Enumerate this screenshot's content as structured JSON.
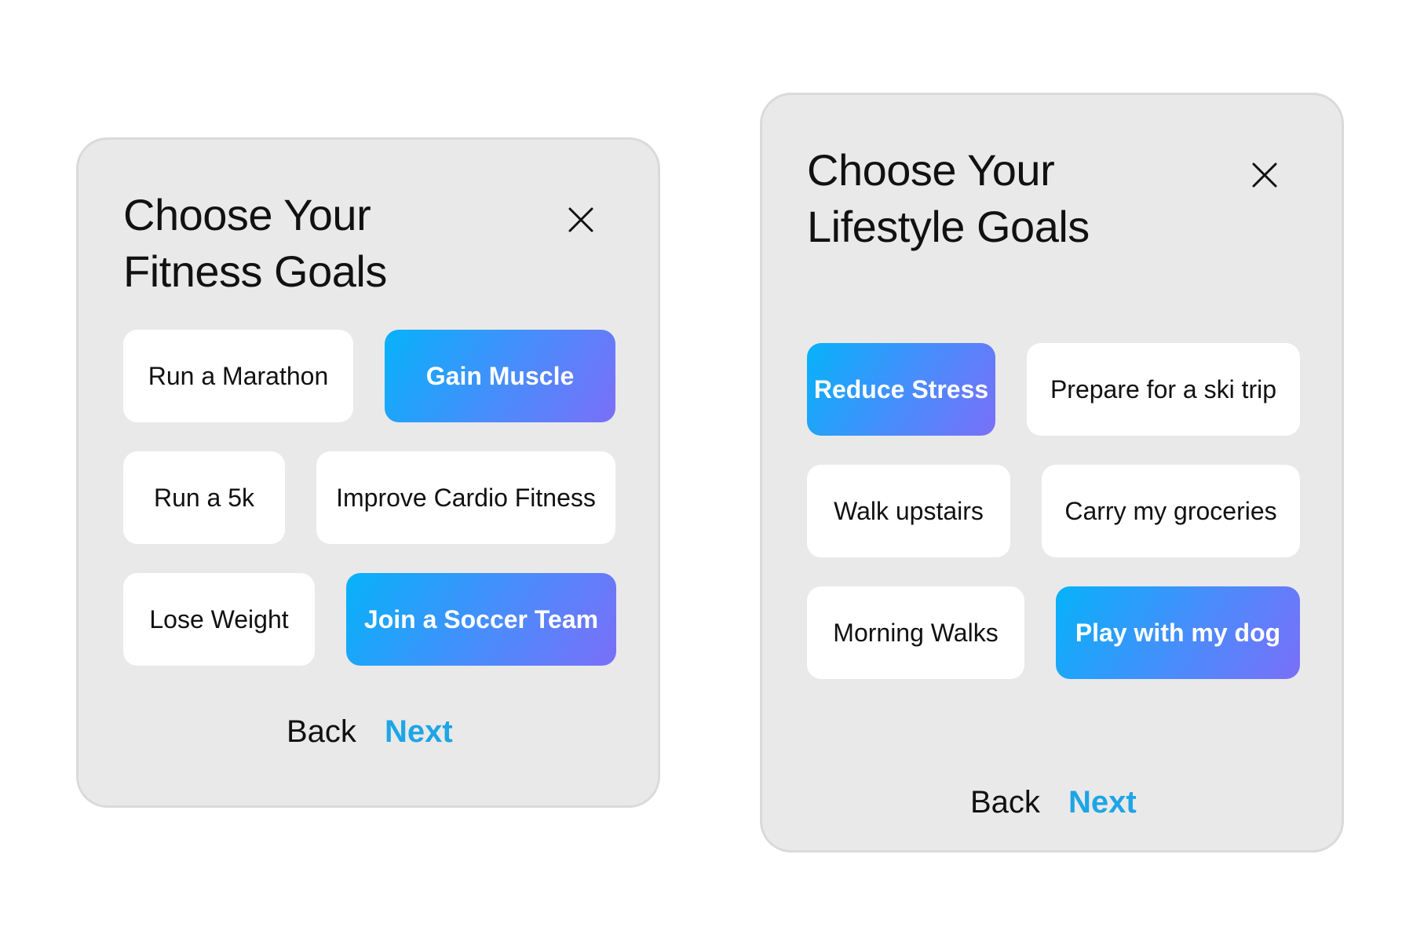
{
  "fitness_card": {
    "title_line1": "Choose Your",
    "title_line2": "Fitness Goals",
    "close_icon": "close-icon",
    "options": [
      {
        "label": "Run a Marathon",
        "selected": false
      },
      {
        "label": "Gain Muscle",
        "selected": true
      },
      {
        "label": "Run a 5k",
        "selected": false
      },
      {
        "label": "Improve Cardio Fitness",
        "selected": false
      },
      {
        "label": "Lose Weight",
        "selected": false
      },
      {
        "label": "Join a Soccer Team",
        "selected": true
      }
    ],
    "back_label": "Back",
    "next_label": "Next"
  },
  "lifestyle_card": {
    "title_line1": "Choose Your",
    "title_line2": "Lifestyle Goals",
    "close_icon": "close-icon",
    "options": [
      {
        "label": "Reduce Stress",
        "selected": true
      },
      {
        "label": "Prepare for a ski trip",
        "selected": false
      },
      {
        "label": "Walk upstairs",
        "selected": false
      },
      {
        "label": "Carry my groceries",
        "selected": false
      },
      {
        "label": "Morning Walks",
        "selected": false
      },
      {
        "label": "Play with my dog",
        "selected": true
      }
    ],
    "back_label": "Back",
    "next_label": "Next"
  },
  "colors": {
    "card_background": "#e9e9ea",
    "chip_background": "#ffffff",
    "selected_gradient_start": "#06b2fa",
    "selected_gradient_end": "#7a6ff8",
    "next_link": "#1ea5e6"
  }
}
